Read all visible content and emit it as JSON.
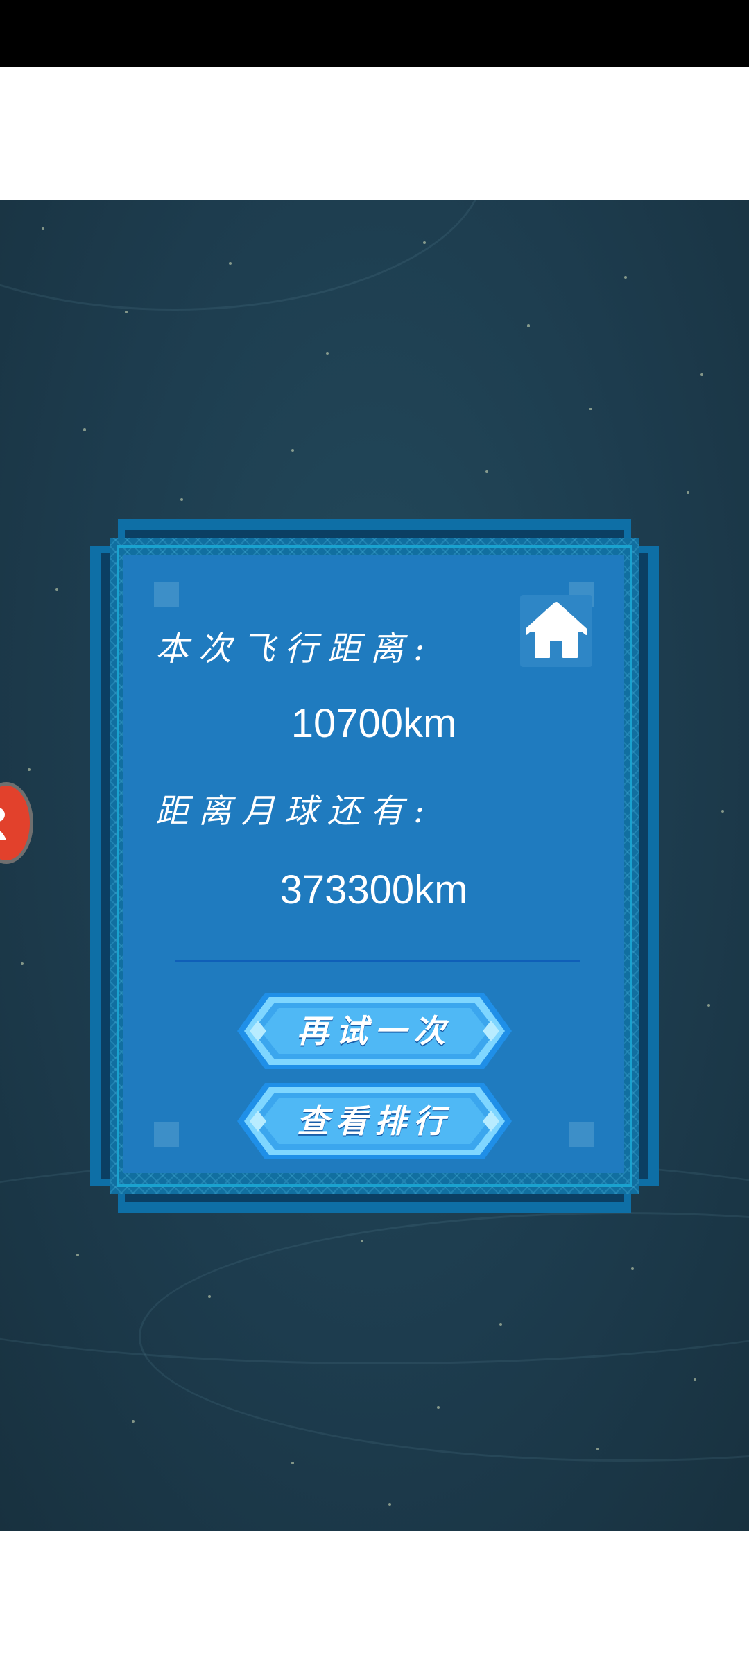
{
  "result": {
    "flight_distance_label": "本次飞行距离:",
    "flight_distance_value": "10700km",
    "remaining_label": "距离月球还有:",
    "remaining_value": "373300km"
  },
  "buttons": {
    "retry_label": "再试一次",
    "ranking_label": "查看排行"
  },
  "icons": {
    "home": "home-icon",
    "floating": "person-icon"
  },
  "colors": {
    "background": "#1d3c4e",
    "panel": "#1f7bbf",
    "frame": "#0e6fa6",
    "button": "#3ba6ee",
    "floating_badge": "#e2412c"
  }
}
